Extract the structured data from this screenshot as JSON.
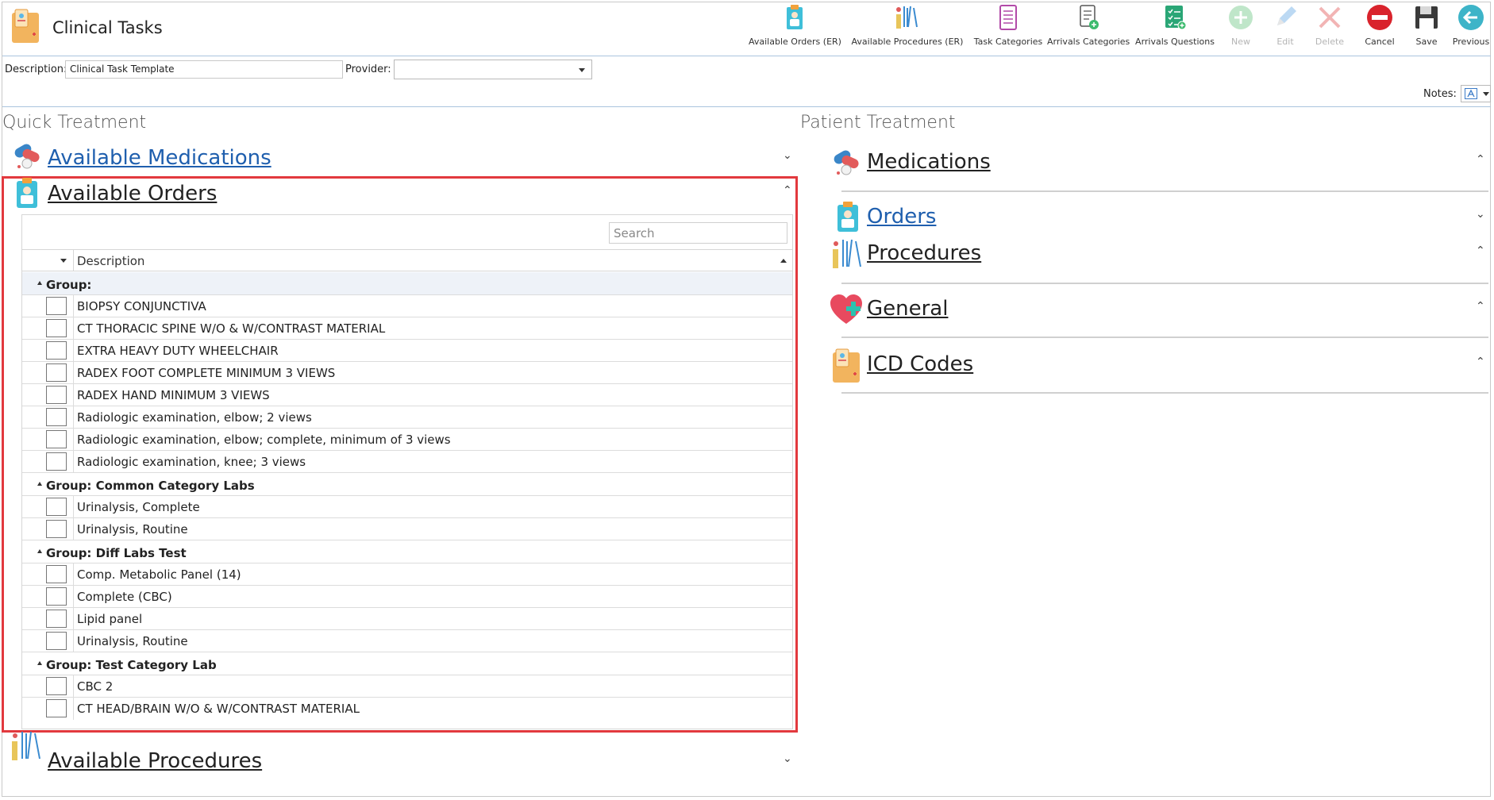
{
  "window": {
    "title": "Clinical Tasks"
  },
  "toolbar": {
    "items": [
      {
        "label": "Available Orders (ER)",
        "icon": "clipboard-doctor-icon",
        "enabled": true
      },
      {
        "label": "Available Procedures (ER)",
        "icon": "surgical-tools-icon",
        "enabled": true
      },
      {
        "label": "Task Categories",
        "icon": "checklist-icon",
        "enabled": true
      },
      {
        "label": "Arrivals Categories",
        "icon": "document-add-icon",
        "enabled": true
      },
      {
        "label": "Arrivals Questions",
        "icon": "green-checklist-icon",
        "enabled": true
      },
      {
        "label": "New",
        "icon": "plus-circle-icon",
        "enabled": false
      },
      {
        "label": "Edit",
        "icon": "pencil-icon",
        "enabled": false
      },
      {
        "label": "Delete",
        "icon": "x-icon",
        "enabled": false
      },
      {
        "label": "Cancel",
        "icon": "no-entry-icon",
        "enabled": true
      },
      {
        "label": "Save",
        "icon": "floppy-disk-icon",
        "enabled": true
      },
      {
        "label": "Previous",
        "icon": "back-arrow-icon",
        "enabled": true
      }
    ]
  },
  "form": {
    "description_label": "Description:",
    "description_value": "Clinical Task Template",
    "provider_label": "Provider:",
    "provider_value": "",
    "notes_label": "Notes:"
  },
  "quick_treatment": {
    "header": "Quick Treatment",
    "available_medications": "Available Medications",
    "available_orders": "Available Orders",
    "available_procedures": "Available Procedures",
    "search_placeholder": "Search",
    "column_description": "Description",
    "groups": [
      {
        "label": "Group:",
        "items": [
          "BIOPSY CONJUNCTIVA",
          "CT THORACIC SPINE W/O & W/CONTRAST MATERIAL",
          "EXTRA HEAVY DUTY WHEELCHAIR",
          "RADEX FOOT COMPLETE MINIMUM 3 VIEWS",
          "RADEX HAND MINIMUM 3 VIEWS",
          "Radiologic examination, elbow; 2 views",
          "Radiologic examination, elbow; complete, minimum of 3 views",
          "Radiologic examination, knee; 3 views"
        ]
      },
      {
        "label": "Group: Common Category Labs",
        "items": [
          "Urinalysis, Complete",
          "Urinalysis, Routine"
        ]
      },
      {
        "label": "Group: Diff Labs Test",
        "items": [
          "Comp. Metabolic Panel (14)",
          "Complete (CBC)",
          "Lipid panel",
          "Urinalysis, Routine"
        ]
      },
      {
        "label": "Group: Test Category Lab",
        "items": [
          "CBC 2",
          "CT HEAD/BRAIN W/O & W/CONTRAST MATERIAL"
        ]
      }
    ]
  },
  "patient_treatment": {
    "header": "Patient Treatment",
    "medications": "Medications",
    "orders": "Orders",
    "procedures": "Procedures",
    "general": "General",
    "icd_codes": "ICD Codes"
  },
  "colors": {
    "link": "#1f5fae",
    "highlight_border": "#e2393e",
    "separator": "#aac4de"
  }
}
